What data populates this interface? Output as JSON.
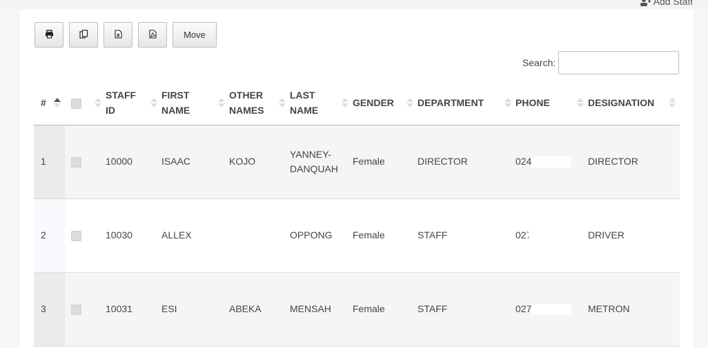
{
  "header": {
    "add_staff_label": "Add Staff",
    "add_staff_icon": "user-plus-icon"
  },
  "toolbar": {
    "buttons": [
      {
        "icon": "print-icon",
        "label": ""
      },
      {
        "icon": "copy-icon",
        "label": ""
      },
      {
        "icon": "excel-icon",
        "label": ""
      },
      {
        "icon": "pdf-icon",
        "label": ""
      }
    ],
    "move_label": "Move"
  },
  "search": {
    "label": "Search:",
    "value": "",
    "placeholder": ""
  },
  "table": {
    "columns": [
      {
        "key": "index",
        "label": "#"
      },
      {
        "key": "select",
        "label": ""
      },
      {
        "key": "staff_id",
        "label": "STAFF ID"
      },
      {
        "key": "first_name",
        "label": "FIRST NAME"
      },
      {
        "key": "other_names",
        "label": "OTHER NAMES"
      },
      {
        "key": "last_name",
        "label": "LAST NAME"
      },
      {
        "key": "gender",
        "label": "GENDER"
      },
      {
        "key": "department",
        "label": "DEPARTMENT"
      },
      {
        "key": "phone",
        "label": "PHONE"
      },
      {
        "key": "designation",
        "label": "DESIGNATION"
      }
    ],
    "rows": [
      {
        "index": "1",
        "staff_id": "10000",
        "first_name": "ISAAC",
        "other_names": "KOJO",
        "last_name": "YANNEY-DANQUAH",
        "gender": "Female",
        "department": "DIRECTOR",
        "phone": "024.",
        "designation": "DIRECTOR"
      },
      {
        "index": "2",
        "staff_id": "10030",
        "first_name": "ALLEX",
        "other_names": "",
        "last_name": "OPPONG",
        "gender": "Female",
        "department": "STAFF",
        "phone": "027",
        "designation": "DRIVER"
      },
      {
        "index": "3",
        "staff_id": "10031",
        "first_name": "ESI",
        "other_names": "ABEKA",
        "last_name": "MENSAH",
        "gender": "Female",
        "department": "STAFF",
        "phone": "027.",
        "designation": "METRON"
      }
    ]
  },
  "colors": {
    "row_odd": "#f5f5f5",
    "row_even": "#ffffff",
    "text": "#444444",
    "border": "#b9b9b9"
  }
}
